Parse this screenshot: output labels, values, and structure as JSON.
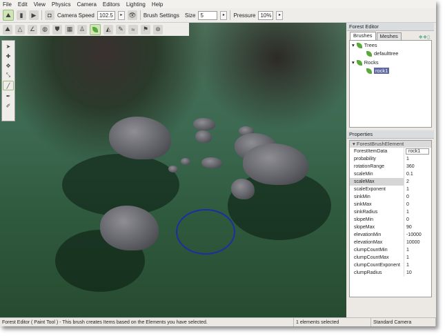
{
  "menu": [
    "File",
    "Edit",
    "View",
    "Physics",
    "Camera",
    "Editors",
    "Lighting",
    "Help"
  ],
  "toolbar": {
    "camera_speed_label": "Camera Speed",
    "camera_speed": "102.5",
    "brush_settings_label": "Brush Settings",
    "size_label": "Size",
    "size": "5",
    "pressure_label": "Pressure",
    "pressure": "10%"
  },
  "forest_editor": {
    "title": "Forest Editor",
    "tabs": [
      "Brushes",
      "Meshes"
    ],
    "tree": [
      {
        "label": "Trees",
        "child": "defaulttree"
      },
      {
        "label": "Rocks",
        "child": "rock1"
      }
    ]
  },
  "properties": {
    "title": "Properties",
    "group": "ForestBrushElement",
    "rows": [
      [
        "ForestItemData",
        "rock1"
      ],
      [
        "probability",
        "1"
      ],
      [
        "rotationRange",
        "360"
      ],
      [
        "scaleMin",
        "0.1"
      ],
      [
        "scaleMax",
        "2"
      ],
      [
        "scaleExponent",
        "1"
      ],
      [
        "sinkMin",
        "0"
      ],
      [
        "sinkMax",
        "0"
      ],
      [
        "sinkRadius",
        "1"
      ],
      [
        "slopeMin",
        "0"
      ],
      [
        "slopeMax",
        "90"
      ],
      [
        "elevationMin",
        "-10000"
      ],
      [
        "elevationMax",
        "10000"
      ],
      [
        "clumpCountMin",
        "1"
      ],
      [
        "clumpCountMax",
        "1"
      ],
      [
        "clumpCountExponent",
        "1"
      ],
      [
        "clumpRadius",
        "10"
      ]
    ]
  },
  "status": {
    "message": "Forest Editor ( Paint Tool ) - This brush creates Items based on the Elements you have selected.",
    "selection": "1 elements selected",
    "camera": "Standard Camera"
  }
}
